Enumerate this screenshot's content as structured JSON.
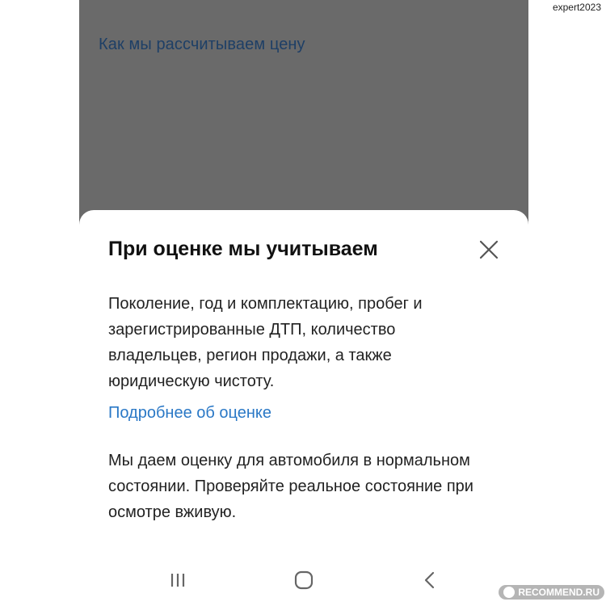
{
  "watermark": {
    "username": "expert2023",
    "site": "RECOMMEND.RU"
  },
  "background": {
    "link_text": "Как мы рассчитываем цену"
  },
  "sheet": {
    "title": "При оценке мы учитываем",
    "paragraph_1": "Поколение, год и комплектацию, пробег и зарегистрированные ДТП, количество владельцев, регион продажи, а также юридическую чистоту.",
    "more_link": "Подробнее об оценке",
    "paragraph_2": "Мы даем оценку для автомобиля в нормальном состоянии. Проверяйте реальное состояние при осмотре вживую.",
    "close_icon": "close-icon"
  },
  "navbar": {
    "icons": [
      "recent-apps-icon",
      "home-icon",
      "back-icon"
    ]
  },
  "colors": {
    "overlay": "#6a6a6a",
    "link_blue": "#2a78c6",
    "bg_link": "#1e3f66",
    "text": "#222222"
  }
}
